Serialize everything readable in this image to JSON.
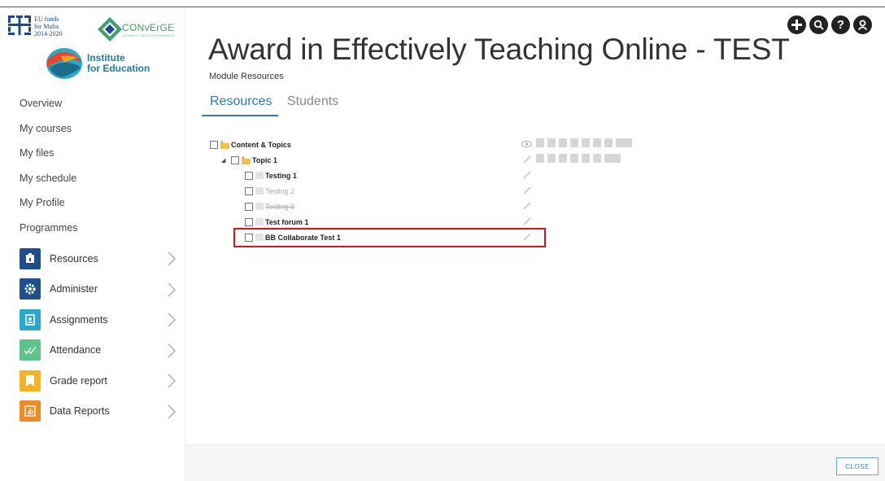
{
  "branding": {
    "eu_text": [
      "EU funds",
      "for Malta",
      "2014-2020"
    ],
    "converge": "CONvErGE",
    "converge_sub": "CONNECTING GOVERNMENT",
    "institute_line1": "Institute",
    "institute_line2": "for Education"
  },
  "nav": [
    "Overview",
    "My courses",
    "My files",
    "My schedule",
    "My Profile",
    "Programmes"
  ],
  "menu": [
    {
      "label": "Resources",
      "color": "#1f4e8c",
      "icon": "resource-icon"
    },
    {
      "label": "Administer",
      "color": "#1f4e8c",
      "icon": "gear-icon"
    },
    {
      "label": "Assignments",
      "color": "#2aa8c9",
      "icon": "assignment-icon"
    },
    {
      "label": "Attendance",
      "color": "#5cc48a",
      "icon": "check-icon"
    },
    {
      "label": "Grade report",
      "color": "#f2b327",
      "icon": "bookmark-icon"
    },
    {
      "label": "Data Reports",
      "color": "#f08a24",
      "icon": "chart-icon"
    }
  ],
  "header": {
    "title": "Award in Effectively Teaching Online - TEST",
    "subtitle": "Module Resources"
  },
  "tabs": {
    "resources": "Resources",
    "students": "Students"
  },
  "top_icons": [
    "plus-icon",
    "search-icon",
    "help-icon",
    "user-icon"
  ],
  "tree": {
    "root": "Content & Topics",
    "topic": "Topic 1",
    "items": [
      {
        "label": "Testing 1",
        "state": "normal"
      },
      {
        "label": "Testing 2",
        "state": "grey"
      },
      {
        "label": "Testing 3",
        "state": "struck"
      },
      {
        "label": "Test forum 1",
        "state": "normal"
      },
      {
        "label": "BB Collaborate Test 1",
        "state": "normal"
      }
    ]
  },
  "footer": {
    "close": "CLOSE"
  },
  "colors": {
    "accent": "#2c7ab6",
    "highlight": "#e0101a"
  }
}
